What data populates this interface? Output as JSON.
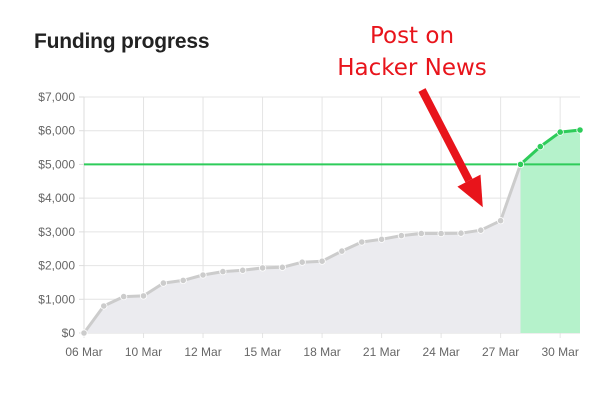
{
  "chart_data": {
    "type": "area",
    "title": "Funding progress",
    "xlabel": "",
    "ylabel": "",
    "x_tick_labels": [
      "06 Mar",
      "10 Mar",
      "12 Mar",
      "15 Mar",
      "18 Mar",
      "21 Mar",
      "24 Mar",
      "27 Mar",
      "30 Mar"
    ],
    "x_tick_dates": [
      "2023-03-06",
      "2023-03-09",
      "2023-03-12",
      "2023-03-15",
      "2023-03-18",
      "2023-03-21",
      "2023-03-24",
      "2023-03-27",
      "2023-03-30"
    ],
    "y_tick_labels": [
      "$0",
      "$1,000",
      "$2,000",
      "$3,000",
      "$4,000",
      "$5,000",
      "$6,000",
      "$7,000"
    ],
    "ylim": [
      0,
      7000
    ],
    "xlim": [
      "2023-03-06",
      "2023-03-31"
    ],
    "grid": true,
    "target_line": {
      "value": 5000,
      "color": "#2ecc5a"
    },
    "series": [
      {
        "color": "#cccccc",
        "fill": "#ebebef",
        "points": [
          {
            "x": "2023-03-06",
            "y": 0
          },
          {
            "x": "2023-03-07",
            "y": 800
          },
          {
            "x": "2023-03-08",
            "y": 1080
          },
          {
            "x": "2023-03-09",
            "y": 1100
          },
          {
            "x": "2023-03-10",
            "y": 1480
          },
          {
            "x": "2023-03-11",
            "y": 1560
          },
          {
            "x": "2023-03-12",
            "y": 1720
          },
          {
            "x": "2023-03-13",
            "y": 1820
          },
          {
            "x": "2023-03-14",
            "y": 1860
          },
          {
            "x": "2023-03-15",
            "y": 1930
          },
          {
            "x": "2023-03-16",
            "y": 1950
          },
          {
            "x": "2023-03-17",
            "y": 2100
          },
          {
            "x": "2023-03-18",
            "y": 2130
          },
          {
            "x": "2023-03-19",
            "y": 2430
          },
          {
            "x": "2023-03-20",
            "y": 2700
          },
          {
            "x": "2023-03-21",
            "y": 2780
          },
          {
            "x": "2023-03-22",
            "y": 2890
          },
          {
            "x": "2023-03-23",
            "y": 2950
          },
          {
            "x": "2023-03-24",
            "y": 2950
          },
          {
            "x": "2023-03-25",
            "y": 2960
          },
          {
            "x": "2023-03-26",
            "y": 3050
          },
          {
            "x": "2023-03-27",
            "y": 3330
          },
          {
            "x": "2023-03-28",
            "y": 5000
          }
        ]
      },
      {
        "color": "#2ecc5a",
        "fill": "#b5f2cb",
        "points": [
          {
            "x": "2023-03-28",
            "y": 5000
          },
          {
            "x": "2023-03-29",
            "y": 5530
          },
          {
            "x": "2023-03-30",
            "y": 5960
          },
          {
            "x": "2023-03-31",
            "y": 6020
          }
        ]
      }
    ],
    "annotation": {
      "lines": [
        "Post on",
        "Hacker News"
      ],
      "color": "#e8141b",
      "arrow_target": {
        "x": "2023-03-26",
        "y": 3700
      }
    }
  }
}
